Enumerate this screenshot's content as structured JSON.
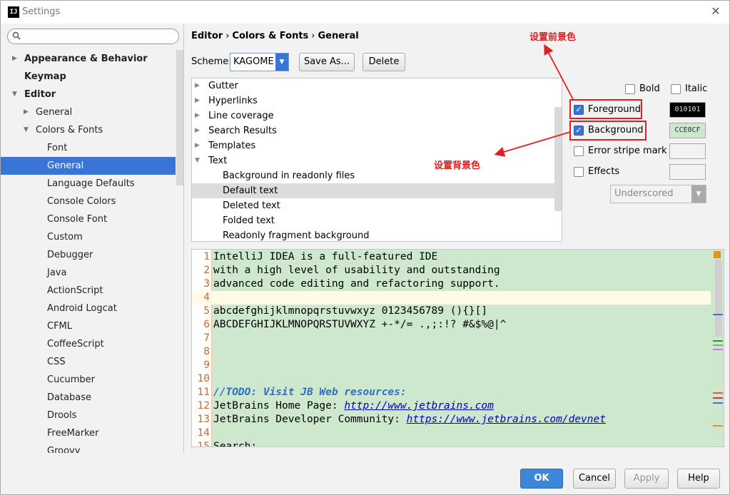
{
  "window": {
    "title": "Settings",
    "app_icon": "IJ"
  },
  "search": {
    "placeholder": ""
  },
  "sidebar": {
    "items": [
      {
        "label": "Appearance & Behavior",
        "level": 0,
        "bold": true,
        "arrow": "▶"
      },
      {
        "label": "Keymap",
        "level": 0,
        "bold": true,
        "arrow": ""
      },
      {
        "label": "Editor",
        "level": 0,
        "bold": true,
        "arrow": "▼"
      },
      {
        "label": "General",
        "level": 1,
        "bold": false,
        "arrow": "▶"
      },
      {
        "label": "Colors & Fonts",
        "level": 1,
        "bold": false,
        "arrow": "▼"
      },
      {
        "label": "Font",
        "level": 2,
        "bold": false,
        "arrow": ""
      },
      {
        "label": "General",
        "level": 2,
        "bold": false,
        "arrow": "",
        "selected": true
      },
      {
        "label": "Language Defaults",
        "level": 2,
        "bold": false,
        "arrow": ""
      },
      {
        "label": "Console Colors",
        "level": 2,
        "bold": false,
        "arrow": ""
      },
      {
        "label": "Console Font",
        "level": 2,
        "bold": false,
        "arrow": ""
      },
      {
        "label": "Custom",
        "level": 2,
        "bold": false,
        "arrow": ""
      },
      {
        "label": "Debugger",
        "level": 2,
        "bold": false,
        "arrow": ""
      },
      {
        "label": "Java",
        "level": 2,
        "bold": false,
        "arrow": ""
      },
      {
        "label": "ActionScript",
        "level": 2,
        "bold": false,
        "arrow": ""
      },
      {
        "label": "Android Logcat",
        "level": 2,
        "bold": false,
        "arrow": ""
      },
      {
        "label": "CFML",
        "level": 2,
        "bold": false,
        "arrow": ""
      },
      {
        "label": "CoffeeScript",
        "level": 2,
        "bold": false,
        "arrow": ""
      },
      {
        "label": "CSS",
        "level": 2,
        "bold": false,
        "arrow": ""
      },
      {
        "label": "Cucumber",
        "level": 2,
        "bold": false,
        "arrow": ""
      },
      {
        "label": "Database",
        "level": 2,
        "bold": false,
        "arrow": ""
      },
      {
        "label": "Drools",
        "level": 2,
        "bold": false,
        "arrow": ""
      },
      {
        "label": "FreeMarker",
        "level": 2,
        "bold": false,
        "arrow": ""
      },
      {
        "label": "Groovy",
        "level": 2,
        "bold": false,
        "arrow": ""
      }
    ]
  },
  "breadcrumb": {
    "part1": "Editor",
    "part2": "Colors & Fonts",
    "part3": "General",
    "sep": "›"
  },
  "scheme": {
    "label": "Scheme:",
    "value": "KAGOME",
    "save_as": "Save As...",
    "delete": "Delete"
  },
  "categories": [
    {
      "label": "Gutter",
      "arrow": "▶",
      "indent": 0
    },
    {
      "label": "Hyperlinks",
      "arrow": "▶",
      "indent": 0
    },
    {
      "label": "Line coverage",
      "arrow": "▶",
      "indent": 0
    },
    {
      "label": "Search Results",
      "arrow": "▶",
      "indent": 0
    },
    {
      "label": "Templates",
      "arrow": "▶",
      "indent": 0
    },
    {
      "label": "Text",
      "arrow": "▼",
      "indent": 0
    },
    {
      "label": "Background in readonly files",
      "arrow": "",
      "indent": 1
    },
    {
      "label": "Default text",
      "arrow": "",
      "indent": 1,
      "selected": true
    },
    {
      "label": "Deleted text",
      "arrow": "",
      "indent": 1
    },
    {
      "label": "Folded text",
      "arrow": "",
      "indent": 1
    },
    {
      "label": "Readonly fragment background",
      "arrow": "",
      "indent": 1
    }
  ],
  "options": {
    "bold": "Bold",
    "italic": "Italic",
    "foreground": "Foreground",
    "foreground_color": "010101",
    "background": "Background",
    "background_color": "CCE8CF",
    "error_stripe": "Error stripe mark",
    "effects": "Effects",
    "effect_type": "Underscored"
  },
  "colors": {
    "foreground_hex": "#010101",
    "background_hex": "#CCE8CF",
    "accent": "#3875d7",
    "annotation": "#e02020"
  },
  "annotations": {
    "foreground_note": "设置前景色",
    "background_note": "设置背景色"
  },
  "preview": {
    "lines": [
      {
        "n": "1",
        "text": "IntelliJ IDEA is a full-featured IDE"
      },
      {
        "n": "2",
        "text": "with a high level of usability and outstanding"
      },
      {
        "n": "3",
        "text": "advanced code editing and refactoring support."
      },
      {
        "n": "4",
        "text": ""
      },
      {
        "n": "5",
        "text": "abcdefghijklmnopqrstuvwxyz 0123456789 (){}[]"
      },
      {
        "n": "6",
        "text": "ABCDEFGHIJKLMNOPQRSTUVWXYZ +-*/= .,;:!? #&$%@|^"
      },
      {
        "n": "7",
        "text": ""
      },
      {
        "n": "8",
        "text": ""
      },
      {
        "n": "9",
        "text": ""
      },
      {
        "n": "10",
        "text": ""
      },
      {
        "n": "11",
        "text": "//TODO: Visit JB Web resources:"
      },
      {
        "n": "12",
        "prefix": "JetBrains Home Page: ",
        "link": "http://www.jetbrains.com"
      },
      {
        "n": "13",
        "prefix": "JetBrains Developer Community: ",
        "link": "https://www.jetbrains.com/devnet"
      },
      {
        "n": "14",
        "text": ""
      },
      {
        "n": "15",
        "text": "Search:"
      }
    ]
  },
  "footer": {
    "ok": "OK",
    "cancel": "Cancel",
    "apply": "Apply",
    "help": "Help"
  }
}
